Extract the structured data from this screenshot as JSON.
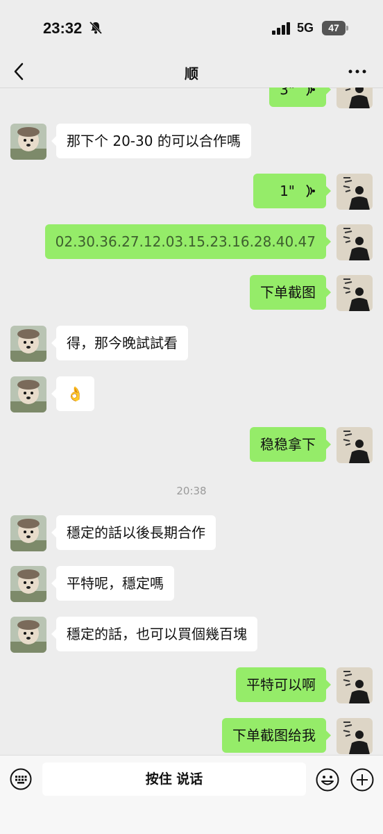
{
  "status": {
    "time": "23:32",
    "network": "5G",
    "battery": "47"
  },
  "nav": {
    "title": "顺"
  },
  "messages": [
    {
      "side": "right",
      "type": "voice",
      "duration": "3\""
    },
    {
      "side": "left",
      "text": "那下个 20-30 的可以合作嗎"
    },
    {
      "side": "right",
      "type": "voice",
      "duration": "1\""
    },
    {
      "side": "right",
      "text": "02.30.36.27.12.03.15.23.16.28.40.47"
    },
    {
      "side": "right",
      "text": "下单截图"
    },
    {
      "side": "left",
      "text": "得，那今晚試試看"
    },
    {
      "side": "left",
      "text": "👌"
    },
    {
      "side": "right",
      "text": "稳稳拿下"
    },
    {
      "timestamp": "20:38"
    },
    {
      "side": "left",
      "text": "穩定的話以後長期合作"
    },
    {
      "side": "left",
      "text": "平特呢，穩定嗎"
    },
    {
      "side": "left",
      "text": "穩定的話，也可以買個幾百塊"
    },
    {
      "side": "right",
      "text": "平特可以啊"
    },
    {
      "side": "right",
      "text": "下单截图给我"
    }
  ],
  "input": {
    "hold_to_talk": "按住 说话"
  }
}
